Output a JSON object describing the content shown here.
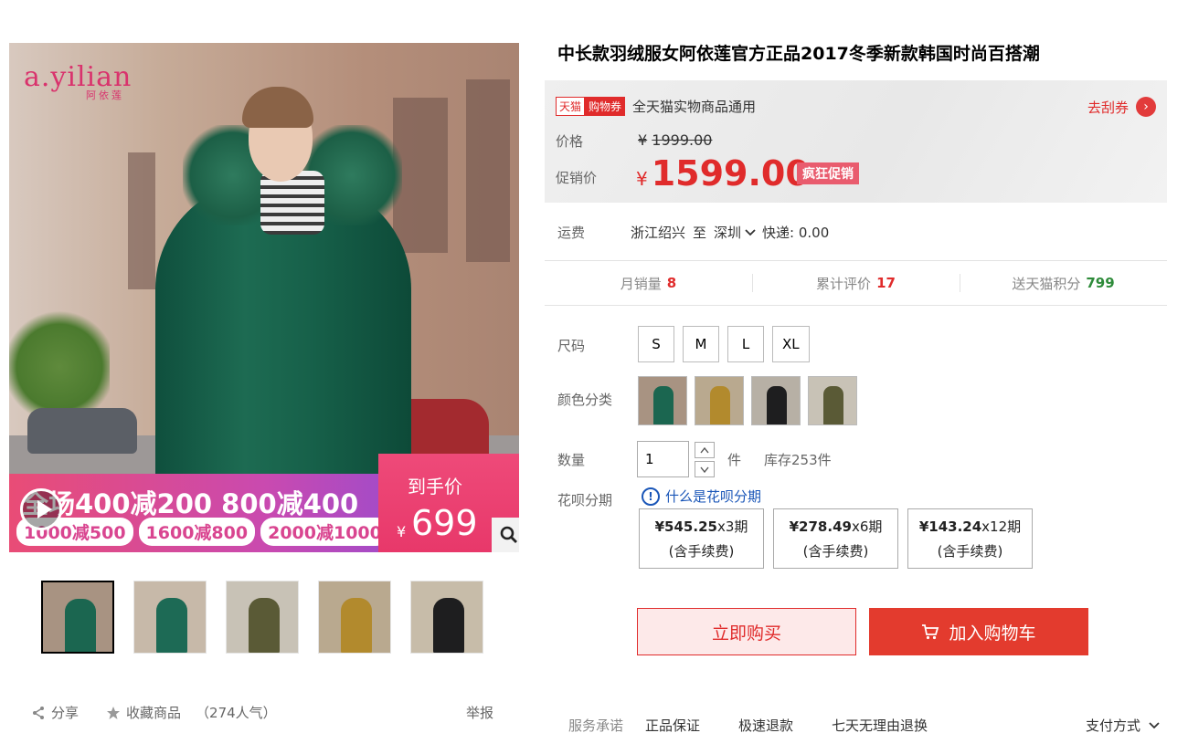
{
  "gallery": {
    "brand_logo": "a.yilian",
    "brand_sub": "阿依莲",
    "promo_line": "全场400减200 800减400",
    "promo_pills": [
      "1000减500",
      "1600减800",
      "2000减1000"
    ],
    "price_label": "到手价",
    "price_currency": "¥",
    "price_value": "699",
    "thumbnails": [
      {
        "bg": "#a89382",
        "coat": "#1b6650"
      },
      {
        "bg": "#c7b9a9",
        "coat": "#1d6a55"
      },
      {
        "bg": "#c8c2b6",
        "coat": "#5a5a36"
      },
      {
        "bg": "#b9a98f",
        "coat": "#b28a2d"
      },
      {
        "bg": "#c7bca9",
        "coat": "#1e1e1f"
      }
    ]
  },
  "product": {
    "title": "中长款羽绒服女阿依莲官方正品2017冬季新款韩国时尚百搭潮"
  },
  "price_panel": {
    "tag_tmall": "天猫",
    "tag_coupon": "购物券",
    "coupon_text": "全天猫实物商品通用",
    "coupon_link": "去刮券",
    "price_label": "价格",
    "original_currency": "¥",
    "original_price": "1999.00",
    "promo_label": "促销价",
    "promo_currency": "¥",
    "promo_price": "1599.00",
    "promo_tag": "疯狂促销"
  },
  "shipping": {
    "label": "运费",
    "from": "浙江绍兴",
    "to_word": "至",
    "to": "深圳",
    "express": "快递: 0.00"
  },
  "stats": [
    {
      "label": "月销量",
      "value": "8"
    },
    {
      "label": "累计评价",
      "value": "17"
    },
    {
      "label": "送天猫积分",
      "value": "799"
    }
  ],
  "options": {
    "size_label": "尺码",
    "sizes": [
      "S",
      "M",
      "L",
      "XL"
    ],
    "color_label": "颜色分类",
    "colors": [
      {
        "bg": "#a89382",
        "coat": "#1b6650"
      },
      {
        "bg": "#b9a98f",
        "coat": "#b28a2d"
      },
      {
        "bg": "#b7b0a5",
        "coat": "#1e1e1f"
      },
      {
        "bg": "#c8c2b6",
        "coat": "#5a5a36"
      }
    ],
    "qty_label": "数量",
    "qty_value": "1",
    "qty_unit": "件",
    "stock": "库存253件"
  },
  "huabei": {
    "label": "花呗分期",
    "link": "什么是花呗分期",
    "plans": [
      {
        "amount": "¥545.25",
        "terms": "x3期",
        "fee": "(含手续费)"
      },
      {
        "amount": "¥278.49",
        "terms": "x6期",
        "fee": "(含手续费)"
      },
      {
        "amount": "¥143.24",
        "terms": "x12期",
        "fee": "(含手续费)"
      }
    ]
  },
  "actions": {
    "buy_now": "立即购买",
    "add_cart": "加入购物车"
  },
  "footer": {
    "share": "分享",
    "favorite": "收藏商品",
    "popularity": "（274人气）",
    "report": "举报",
    "service_label": "服务承诺",
    "services": [
      "正品保证",
      "极速退款",
      "七天无理由退换"
    ],
    "payment": "支付方式"
  },
  "colors": {
    "accent_red": "#e02b2b",
    "stat_green": "#2e8b3a",
    "link_blue": "#1a56b8",
    "promo_pink": "#e94c76"
  }
}
